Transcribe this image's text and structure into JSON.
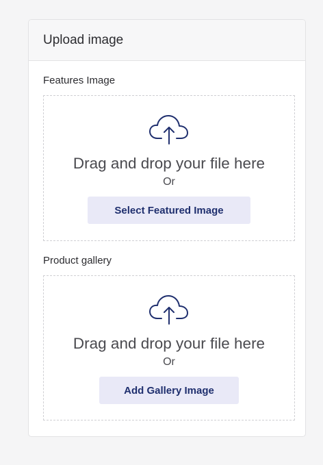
{
  "card": {
    "title": "Upload image"
  },
  "featured": {
    "label": "Features Image",
    "drop_text": "Drag and drop your file here",
    "or_text": "Or",
    "button_label": "Select Featured Image"
  },
  "gallery": {
    "label": "Product gallery",
    "drop_text": "Drag and drop your file here",
    "or_text": "Or",
    "button_label": "Add Gallery Image"
  },
  "icons": {
    "upload": "cloud-upload-icon"
  },
  "colors": {
    "background": "#f5f5f6",
    "card": "#ffffff",
    "header": "#f7f7f8",
    "button_bg": "#e9e9f7",
    "button_text": "#1f2f6e",
    "text": "#2c2c30",
    "dashed_border": "#cfcfd3"
  }
}
